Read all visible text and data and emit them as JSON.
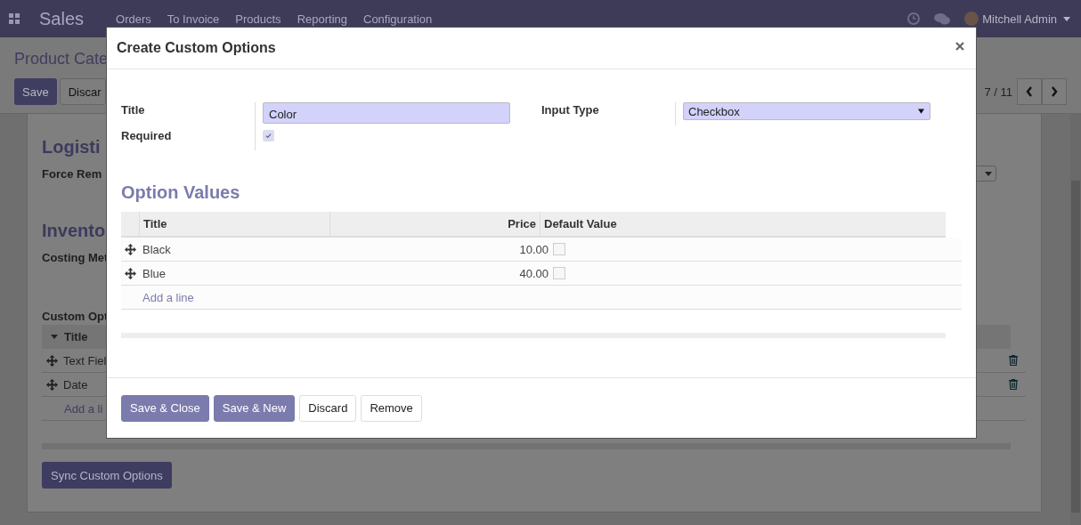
{
  "app": {
    "name": "Sales",
    "menu": [
      "Orders",
      "To Invoice",
      "Products",
      "Reporting",
      "Configuration"
    ],
    "user": "Mitchell Admin"
  },
  "breadcrumb": "Product Cate",
  "actions": [
    "Save",
    "Discar"
  ],
  "pager": "7 / 11",
  "form": {
    "sections": [
      {
        "heading": "Logisti",
        "label": "Force Rem"
      },
      {
        "heading": "Invento",
        "label": "Costing Met"
      }
    ],
    "custom_options": {
      "label": "Custom Opt",
      "column": "Title",
      "rows": [
        "Text Fiel",
        "Date"
      ],
      "add_line": "Add a li"
    },
    "sync_button": "Sync Custom Options"
  },
  "dialog": {
    "title": "Create Custom Options",
    "title_field": {
      "label": "Title",
      "value": "Color"
    },
    "required": {
      "label": "Required",
      "checked": true
    },
    "input_type": {
      "label": "Input Type",
      "value": "Checkbox"
    },
    "section": "Option Values",
    "columns": [
      "Title",
      "Price",
      "Default Value"
    ],
    "rows": [
      {
        "title": "Black",
        "price": "10.00",
        "default": false
      },
      {
        "title": "Blue",
        "price": "40.00",
        "default": false
      }
    ],
    "add_line": "Add a line",
    "buttons": [
      {
        "label": "Save & Close",
        "kind": "primary"
      },
      {
        "label": "Save & New",
        "kind": "primary"
      },
      {
        "label": "Discard",
        "kind": "secondary"
      },
      {
        "label": "Remove",
        "kind": "secondary"
      }
    ]
  }
}
